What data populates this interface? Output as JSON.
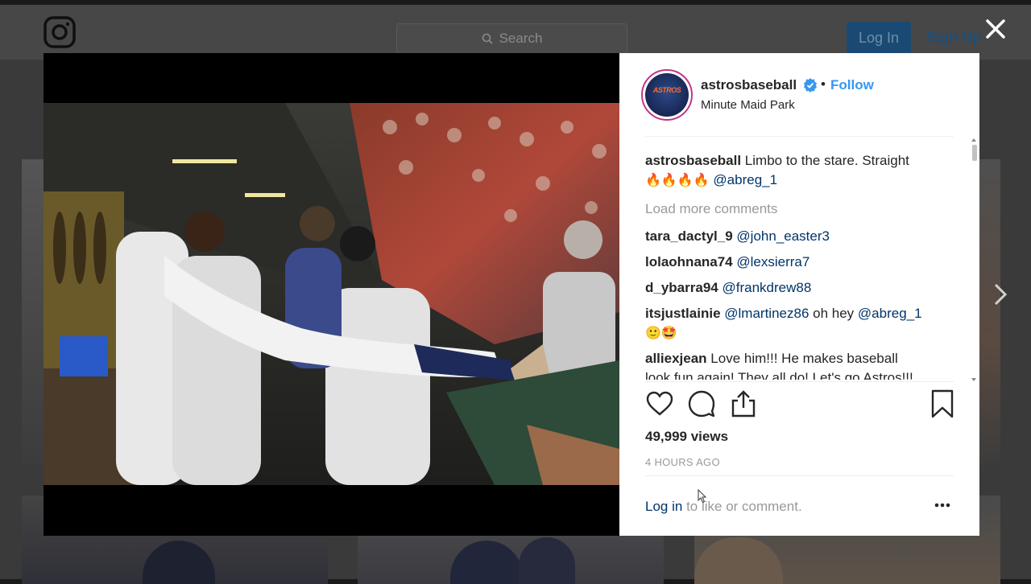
{
  "background": {
    "search_placeholder": "Search",
    "login_label": "Log In",
    "signup_label": "Sign Up"
  },
  "post": {
    "username": "astrosbaseball",
    "follow_label": "Follow",
    "separator": "•",
    "location": "Minute Maid Park",
    "avatar_text": "ASTROS",
    "caption_text": "Limbo to the stare. Straight",
    "caption_emojis": "🔥🔥🔥🔥",
    "caption_mention": "@abreg_1",
    "load_more": "Load more comments",
    "comments": [
      {
        "user": "tara_dactyl_9",
        "text": "@john_easter3"
      },
      {
        "user": "lolaohnana74",
        "text": "@lexsierra7"
      },
      {
        "user": "d_ybarra94",
        "text": "@frankdrew88"
      },
      {
        "user": "itsjustlainie",
        "mention1": "@lmartinez86",
        "text": "oh hey",
        "mention2": "@abreg_1",
        "emojis": "🙂🤩"
      },
      {
        "user": "alliexjean",
        "text": "Love him!!! He makes baseball",
        "text2": "look fun again! They all do! Let's go Astros!!!"
      }
    ],
    "views": "49,999 views",
    "time_ago": "4 HOURS AGO",
    "footer_login": "Log in",
    "footer_rest": "to like or comment."
  },
  "colors": {
    "link_blue": "#3897f0",
    "mention_blue": "#003569",
    "text": "#262626",
    "muted": "#999999"
  },
  "icons": [
    "instagram-logo-icon",
    "search-icon",
    "close-icon",
    "chevron-right-icon",
    "verified-icon",
    "heart-icon",
    "comment-icon",
    "share-icon",
    "bookmark-icon",
    "more-options-icon"
  ]
}
